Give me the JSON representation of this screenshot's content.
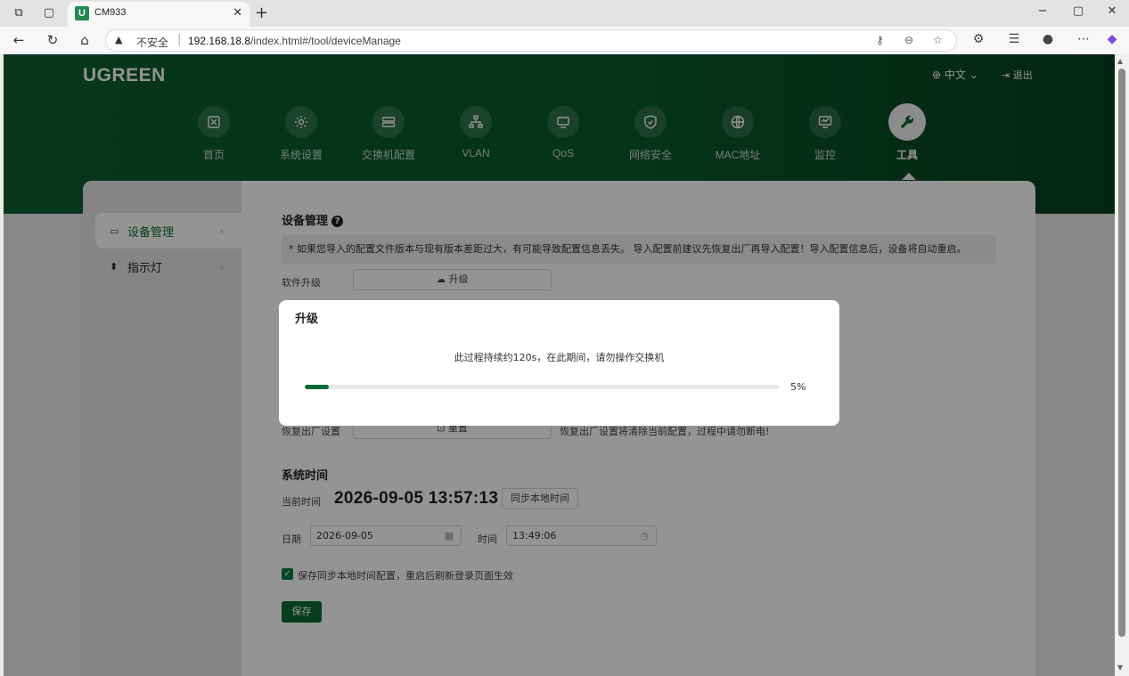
{
  "browser": {
    "tab_title": "CM933",
    "tab_favicon": "U",
    "url_warning": "不安全",
    "url_host": "192.168.18.8",
    "url_path": "/index.html#/tool/deviceManage"
  },
  "header": {
    "logo": "UGREEN",
    "language": "中文",
    "logout": "退出"
  },
  "nav": [
    {
      "label": "首页",
      "icon": "home-icon"
    },
    {
      "label": "系统设置",
      "icon": "gear-icon"
    },
    {
      "label": "交换机配置",
      "icon": "switch-icon"
    },
    {
      "label": "VLAN",
      "icon": "network-icon"
    },
    {
      "label": "QoS",
      "icon": "qos-icon"
    },
    {
      "label": "网络安全",
      "icon": "shield-icon"
    },
    {
      "label": "MAC地址",
      "icon": "globe-icon"
    },
    {
      "label": "监控",
      "icon": "monitor-icon"
    },
    {
      "label": "工具",
      "icon": "wrench-icon",
      "active": true
    }
  ],
  "sidebar": {
    "items": [
      {
        "label": "设备管理",
        "icon": "device-icon",
        "active": true
      },
      {
        "label": "指示灯",
        "icon": "led-icon"
      }
    ]
  },
  "device_manage": {
    "title": "设备管理",
    "notice": "* 如果您导入的配置文件版本与现有版本差距过大，有可能导致配置信息丢失。 导入配置前建议先恢复出厂再导入配置！导入配置信息后，设备将自动重启。",
    "software_upgrade_label": "软件升级",
    "upgrade_button": "升级",
    "factory_reset_label": "恢复出厂设置",
    "reset_button": "重置",
    "reset_note": "恢复出厂设置将清除当前配置，过程中请勿断电!"
  },
  "system_time": {
    "title": "系统时间",
    "current_label": "当前时间",
    "current_value": "2026-09-05 13:57:13",
    "sync_button": "同步本地时间",
    "date_label": "日期",
    "date_value": "2026-09-05",
    "time_label": "时间",
    "time_value": "13:49:06",
    "checkbox_label": "保存同步本地时间配置，重启后刷新登录页面生效",
    "checkbox_checked": true,
    "save_button": "保存"
  },
  "modal": {
    "title": "升级",
    "message": "此过程持续约120s，在此期间，请勿操作交换机",
    "progress_percent": 5,
    "progress_text": "5%"
  },
  "colors": {
    "brand_green": "#0b6b36",
    "header_green": "#0b5d31"
  }
}
